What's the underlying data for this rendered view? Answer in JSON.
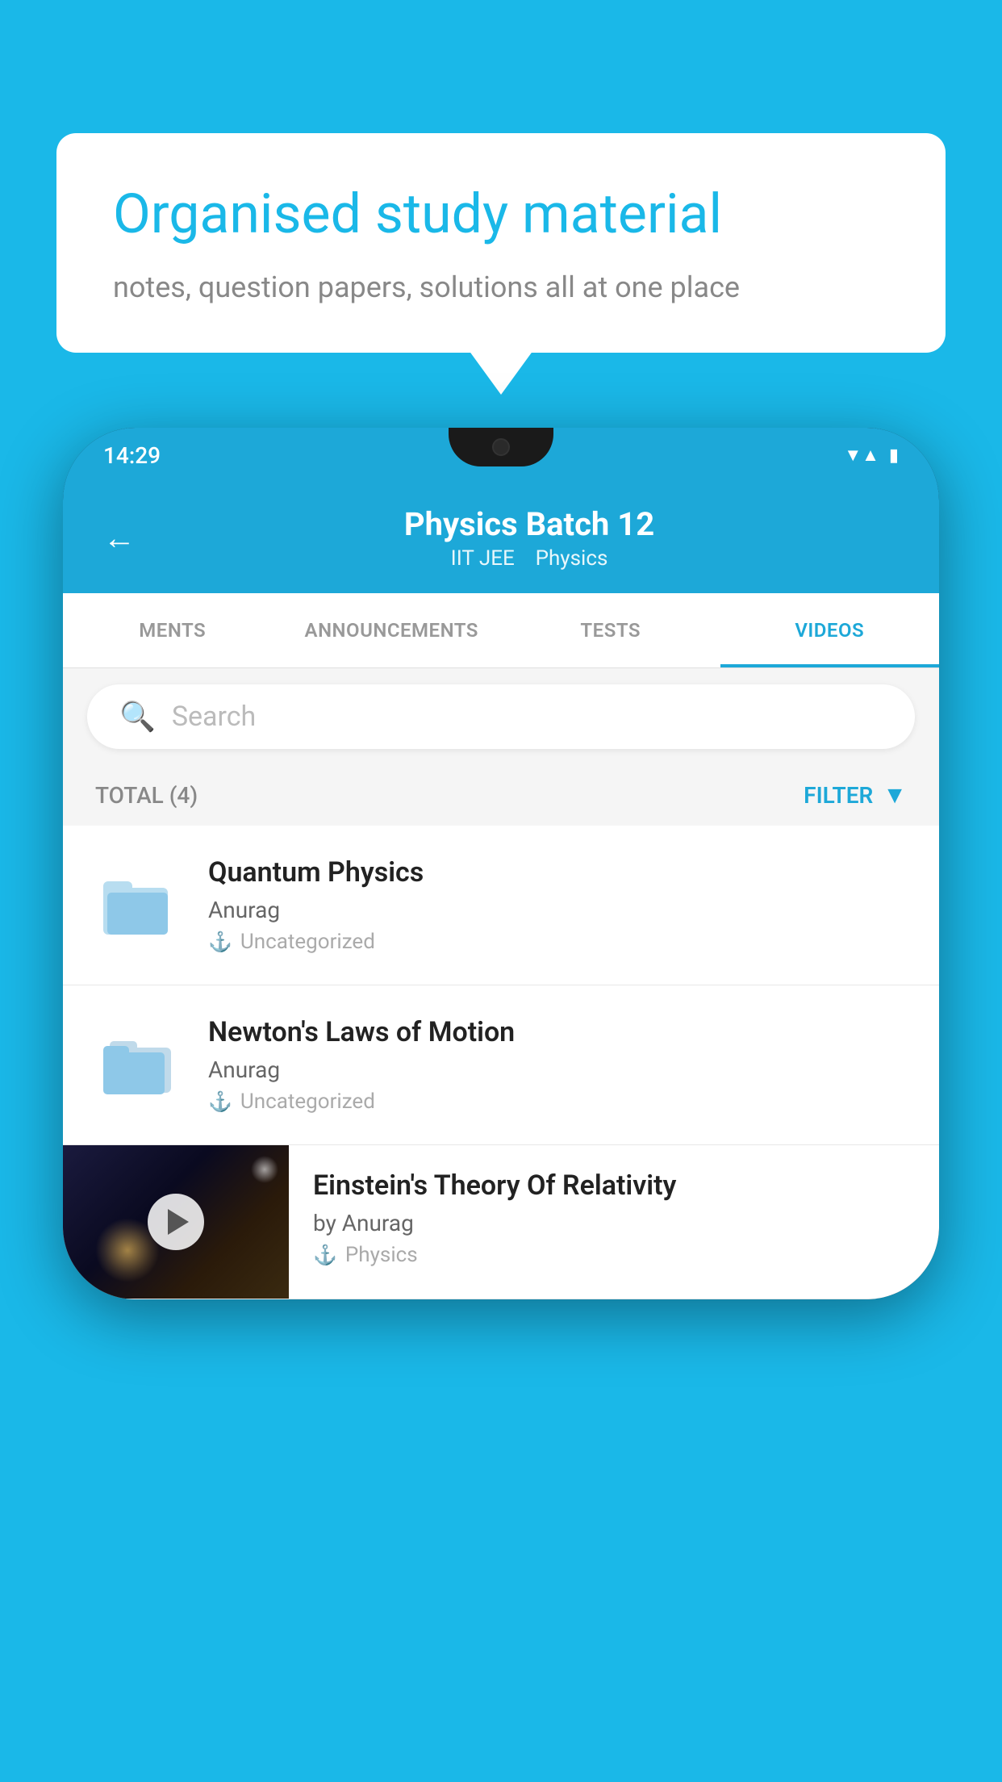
{
  "background": {
    "color": "#1ab8e8"
  },
  "speech_bubble": {
    "title": "Organised study material",
    "subtitle": "notes, question papers, solutions all at one place"
  },
  "status_bar": {
    "time": "14:29",
    "wifi": "▼",
    "signal": "▲",
    "battery": "▮"
  },
  "app_bar": {
    "title": "Physics Batch 12",
    "subtitle_part1": "IIT JEE",
    "subtitle_part2": "Physics",
    "back_label": "←"
  },
  "tabs": [
    {
      "label": "MENTS",
      "active": false
    },
    {
      "label": "ANNOUNCEMENTS",
      "active": false
    },
    {
      "label": "TESTS",
      "active": false
    },
    {
      "label": "VIDEOS",
      "active": true
    }
  ],
  "search": {
    "placeholder": "Search"
  },
  "filter_bar": {
    "total_label": "TOTAL (4)",
    "filter_label": "FILTER"
  },
  "videos": [
    {
      "title": "Quantum Physics",
      "author": "Anurag",
      "category": "Uncategorized",
      "has_thumbnail": false
    },
    {
      "title": "Newton's Laws of Motion",
      "author": "Anurag",
      "category": "Uncategorized",
      "has_thumbnail": false
    },
    {
      "title": "Einstein's Theory Of Relativity",
      "author": "by Anurag",
      "category": "Physics",
      "has_thumbnail": true
    }
  ]
}
